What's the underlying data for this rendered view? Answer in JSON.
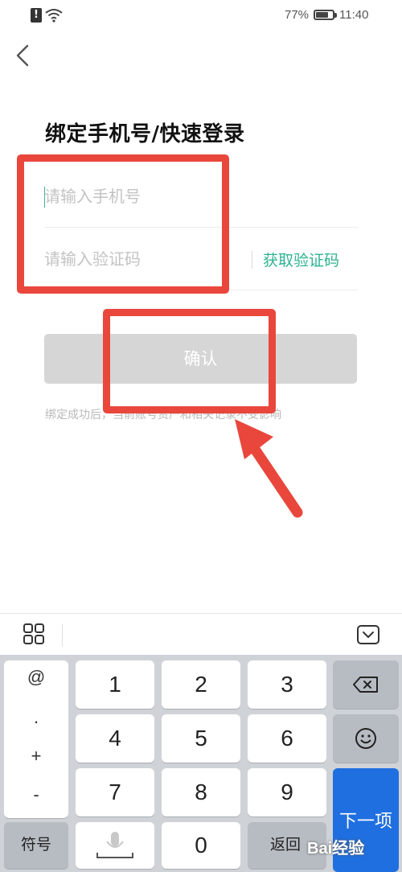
{
  "status_bar": {
    "battery_percent": "77%",
    "battery_level": 0.77,
    "time": "11:40",
    "alert_glyph": "!"
  },
  "header": {
    "title": "绑定手机号/快速登录"
  },
  "form": {
    "phone_placeholder": "请输入手机号",
    "code_placeholder": "请输入验证码",
    "get_code_label": "获取验证码",
    "confirm_label": "确认",
    "notice": "绑定成功后，当前账号资产和相关记录不受影响"
  },
  "keyboard": {
    "symbols": [
      "@",
      ".",
      "+",
      "-"
    ],
    "row1": [
      "1",
      "2",
      "3"
    ],
    "row2": [
      "4",
      "5",
      "6"
    ],
    "row3": [
      "7",
      "8",
      "9"
    ],
    "symbol_label": "符号",
    "zero": "0",
    "return_label": "返回",
    "next_label": "下一项"
  },
  "watermark": {
    "text": "Bai经验"
  },
  "colors": {
    "accent": "#2fb293",
    "annotation_red": "#e9473c",
    "next_blue": "#1f6fe0",
    "disabled_button": "#d6d6d6"
  }
}
